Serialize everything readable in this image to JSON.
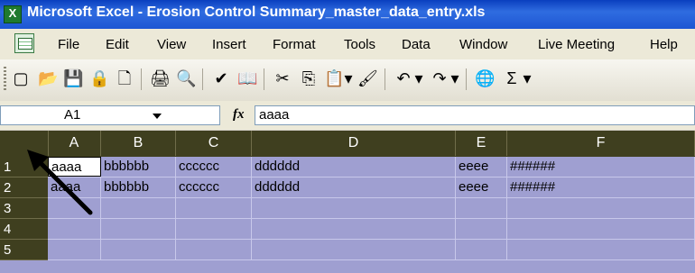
{
  "window": {
    "title": "Microsoft Excel - Erosion Control Summary_master_data_entry.xls"
  },
  "menu": [
    "File",
    "Edit",
    "View",
    "Insert",
    "Format",
    "Tools",
    "Data",
    "Window",
    "Live Meeting",
    "Help"
  ],
  "toolbar": {
    "icons": [
      "new-icon",
      "open-icon",
      "save-icon",
      "permission-icon",
      "print-preview-icon",
      "print-icon",
      "print-preview-2-icon",
      "spelling-icon",
      "research-icon",
      "cut-icon",
      "copy-icon",
      "paste-icon",
      "paste-dropdown-icon",
      "format-painter-icon",
      "undo-icon",
      "undo-dropdown-icon",
      "redo-icon",
      "redo-dropdown-icon",
      "hyperlink-icon",
      "autosum-icon",
      "autosum-dropdown-icon"
    ],
    "glyphs": [
      "▢",
      "📂",
      "💾",
      "🔒",
      "🗋",
      "🖨",
      "🔍",
      "✔",
      "📖",
      "✂",
      "⎘",
      "📋",
      "▾",
      "🖌",
      "↶",
      "▾",
      "↷",
      "▾",
      "🌐",
      "Σ",
      "▾"
    ]
  },
  "formula_bar": {
    "name_box": "A1",
    "fx": "fx",
    "content": "aaaa"
  },
  "columns": [
    "A",
    "B",
    "C",
    "D",
    "E",
    "F"
  ],
  "rows": [
    {
      "num": "1",
      "cells": [
        "aaaa",
        "bbbbbb",
        "cccccc",
        "dddddd",
        "eeee",
        "######"
      ]
    },
    {
      "num": "2",
      "cells": [
        "aaaa",
        "bbbbbb",
        "cccccc",
        "dddddd",
        "eeee",
        "######"
      ]
    },
    {
      "num": "3",
      "cells": [
        "",
        "",
        "",
        "",
        "",
        ""
      ]
    },
    {
      "num": "4",
      "cells": [
        "",
        "",
        "",
        "",
        "",
        ""
      ]
    },
    {
      "num": "5",
      "cells": [
        "",
        "",
        "",
        "",
        "",
        ""
      ]
    }
  ],
  "colors": {
    "grid_fill": "#9f9fd1",
    "header_fill": "#3f3f1f",
    "title_blue": "#1d56d3"
  }
}
